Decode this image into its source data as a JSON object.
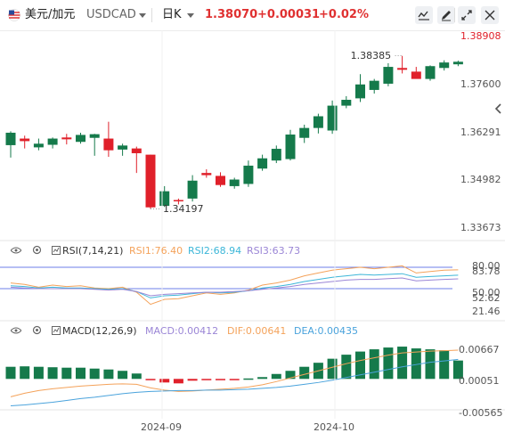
{
  "header": {
    "symbol_name": "美元/加元",
    "symbol_code": "USDCAD",
    "timeframe": "日K",
    "price": "1.38070",
    "change": "+0.00031",
    "change_pct": "+0.02%"
  },
  "colors": {
    "up": "#157a4b",
    "down": "#e0202a",
    "rsi1": "#f4a25a",
    "rsi2": "#3cb6d8",
    "rsi3": "#9b86d6",
    "macd_dif": "#f4a25a",
    "macd_dea": "#4aa3dc",
    "ref_line": "#6d7fe8"
  },
  "icons": [
    "flag-icon",
    "caret-down-icon",
    "indicator-icon",
    "draw-pencil-icon",
    "bar-toggle-icon",
    "fullscreen-icon",
    "settings-icon",
    "collapse-left-icon",
    "eye-icon",
    "gear-icon"
  ],
  "chart_data": [
    {
      "type": "candlestick",
      "title": "美元/加元 USDCAD 日K",
      "x_tick_labels": [
        "2024-09",
        "2024-10"
      ],
      "y_axis_labels": [
        "1.38908",
        "1.37600",
        "1.36291",
        "1.34982",
        "1.33673"
      ],
      "y_axis_values": [
        1.38908,
        1.376,
        1.36291,
        1.34982,
        1.33673
      ],
      "ylim": [
        1.3343,
        1.3908
      ],
      "annotations": [
        {
          "text": "1.38385",
          "value": 1.38385
        },
        {
          "text": "1.34197",
          "value": 1.34197
        }
      ],
      "candles": [
        {
          "o": 1.3594,
          "h": 1.3632,
          "l": 1.356,
          "c": 1.3628
        },
        {
          "o": 1.3612,
          "h": 1.362,
          "l": 1.3585,
          "c": 1.3605
        },
        {
          "o": 1.3588,
          "h": 1.3612,
          "l": 1.358,
          "c": 1.3598
        },
        {
          "o": 1.3595,
          "h": 1.3615,
          "l": 1.3585,
          "c": 1.3612
        },
        {
          "o": 1.3615,
          "h": 1.3625,
          "l": 1.3596,
          "c": 1.361
        },
        {
          "o": 1.3603,
          "h": 1.3628,
          "l": 1.3598,
          "c": 1.3622
        },
        {
          "o": 1.3614,
          "h": 1.3625,
          "l": 1.3565,
          "c": 1.3624
        },
        {
          "o": 1.3612,
          "h": 1.3658,
          "l": 1.3562,
          "c": 1.358
        },
        {
          "o": 1.3582,
          "h": 1.3598,
          "l": 1.3565,
          "c": 1.3593
        },
        {
          "o": 1.3585,
          "h": 1.359,
          "l": 1.3518,
          "c": 1.3572
        },
        {
          "o": 1.3568,
          "h": 1.3568,
          "l": 1.342,
          "c": 1.3424
        },
        {
          "o": 1.3428,
          "h": 1.3482,
          "l": 1.3425,
          "c": 1.3468
        },
        {
          "o": 1.3444,
          "h": 1.3448,
          "l": 1.3432,
          "c": 1.3441
        },
        {
          "o": 1.3448,
          "h": 1.3512,
          "l": 1.344,
          "c": 1.3497
        },
        {
          "o": 1.3518,
          "h": 1.3528,
          "l": 1.3505,
          "c": 1.3512
        },
        {
          "o": 1.351,
          "h": 1.352,
          "l": 1.348,
          "c": 1.3485
        },
        {
          "o": 1.3482,
          "h": 1.3505,
          "l": 1.3475,
          "c": 1.35
        },
        {
          "o": 1.3488,
          "h": 1.3552,
          "l": 1.348,
          "c": 1.3538
        },
        {
          "o": 1.353,
          "h": 1.3568,
          "l": 1.3524,
          "c": 1.3558
        },
        {
          "o": 1.3552,
          "h": 1.3593,
          "l": 1.3545,
          "c": 1.3584
        },
        {
          "o": 1.3556,
          "h": 1.3636,
          "l": 1.3552,
          "c": 1.3623
        },
        {
          "o": 1.3614,
          "h": 1.365,
          "l": 1.36,
          "c": 1.3641
        },
        {
          "o": 1.3641,
          "h": 1.368,
          "l": 1.3626,
          "c": 1.3673
        },
        {
          "o": 1.3634,
          "h": 1.3716,
          "l": 1.3625,
          "c": 1.3702
        },
        {
          "o": 1.3702,
          "h": 1.3728,
          "l": 1.3695,
          "c": 1.3718
        },
        {
          "o": 1.3722,
          "h": 1.3788,
          "l": 1.3712,
          "c": 1.376
        },
        {
          "o": 1.3745,
          "h": 1.3775,
          "l": 1.3735,
          "c": 1.377
        },
        {
          "o": 1.3762,
          "h": 1.3818,
          "l": 1.3755,
          "c": 1.3808
        },
        {
          "o": 1.3805,
          "h": 1.3838,
          "l": 1.379,
          "c": 1.38
        },
        {
          "o": 1.3795,
          "h": 1.3808,
          "l": 1.3778,
          "c": 1.3775
        },
        {
          "o": 1.3775,
          "h": 1.3812,
          "l": 1.377,
          "c": 1.381
        },
        {
          "o": 1.3805,
          "h": 1.3826,
          "l": 1.3798,
          "c": 1.382
        },
        {
          "o": 1.3815,
          "h": 1.3825,
          "l": 1.381,
          "c": 1.3822
        }
      ]
    },
    {
      "type": "line",
      "title": "RSI(7,14,21)",
      "ylim": [
        10,
        95
      ],
      "y_axis_labels": [
        "80.00",
        "83.78",
        "50.00",
        "52.62",
        "21.46"
      ],
      "legend": [
        {
          "text": "RSI1:76.40",
          "color": "#f4a25a"
        },
        {
          "text": "RSI2:68.94",
          "color": "#3cb6d8"
        },
        {
          "text": "RSI3:63.73",
          "color": "#9b86d6"
        }
      ],
      "reference_lines": [
        80,
        50
      ],
      "series": [
        {
          "values": [
            58,
            56,
            52,
            55,
            53,
            54,
            51,
            50,
            52,
            45,
            28,
            35,
            36,
            40,
            44,
            42,
            44,
            48,
            55,
            58,
            62,
            68,
            72,
            76,
            78,
            80,
            78,
            80,
            82,
            72,
            74,
            76,
            76.4
          ]
        },
        {
          "values": [
            54,
            53,
            51,
            52,
            51,
            51,
            50,
            49,
            50,
            46,
            37,
            40,
            41,
            43,
            45,
            44,
            45,
            47,
            51,
            53,
            56,
            60,
            63,
            66,
            68,
            70,
            69,
            70,
            71,
            66,
            67,
            68,
            68.94
          ]
        },
        {
          "values": [
            52,
            51,
            50,
            50,
            50,
            50,
            49,
            48,
            49,
            46,
            40,
            42,
            43,
            44,
            45,
            45,
            46,
            47,
            49,
            51,
            53,
            56,
            58,
            60,
            62,
            63,
            63,
            64,
            65,
            61,
            62,
            63,
            63.73
          ]
        }
      ]
    },
    {
      "type": "bar",
      "title": "MACD(12,26,9)",
      "ylim": [
        -0.0065,
        0.009
      ],
      "y_axis_labels": [
        "0.00667",
        "0.00051",
        "-0.00565"
      ],
      "legend": [
        {
          "text": "MACD:0.00412",
          "color": "#9b86d6"
        },
        {
          "text": "DIF:0.00641",
          "color": "#f4a25a"
        },
        {
          "text": "DEA:0.00435",
          "color": "#4aa3dc"
        }
      ],
      "histogram": [
        0.0027,
        0.0028,
        0.0027,
        0.0026,
        0.0025,
        0.0025,
        0.0023,
        0.0021,
        0.0018,
        0.0012,
        -0.0003,
        -0.0008,
        -0.001,
        -0.0004,
        -0.0002,
        -0.0002,
        -0.0001,
        0.0001,
        0.0004,
        0.0011,
        0.0018,
        0.0027,
        0.0036,
        0.0045,
        0.0054,
        0.0061,
        0.0066,
        0.007,
        0.0072,
        0.0068,
        0.0066,
        0.0064,
        0.0041
      ],
      "dif": [
        -0.004,
        -0.0032,
        -0.0026,
        -0.0022,
        -0.0019,
        -0.0016,
        -0.0014,
        -0.0012,
        -0.0011,
        -0.0012,
        -0.002,
        -0.0025,
        -0.0028,
        -0.0027,
        -0.0025,
        -0.0023,
        -0.0021,
        -0.0018,
        -0.0013,
        -0.0006,
        0.0002,
        0.001,
        0.0018,
        0.0026,
        0.0034,
        0.0041,
        0.0047,
        0.0053,
        0.0058,
        0.006,
        0.0062,
        0.0063,
        0.00641
      ],
      "dea": [
        -0.006,
        -0.0058,
        -0.0055,
        -0.0052,
        -0.0048,
        -0.0044,
        -0.0041,
        -0.0037,
        -0.0033,
        -0.003,
        -0.0028,
        -0.0027,
        -0.0026,
        -0.0026,
        -0.0025,
        -0.0025,
        -0.0024,
        -0.0023,
        -0.0021,
        -0.0019,
        -0.0016,
        -0.0012,
        -0.0008,
        -0.0003,
        0.0003,
        0.0009,
        0.0015,
        0.0021,
        0.0027,
        0.0032,
        0.0037,
        0.004,
        0.00435
      ]
    }
  ]
}
